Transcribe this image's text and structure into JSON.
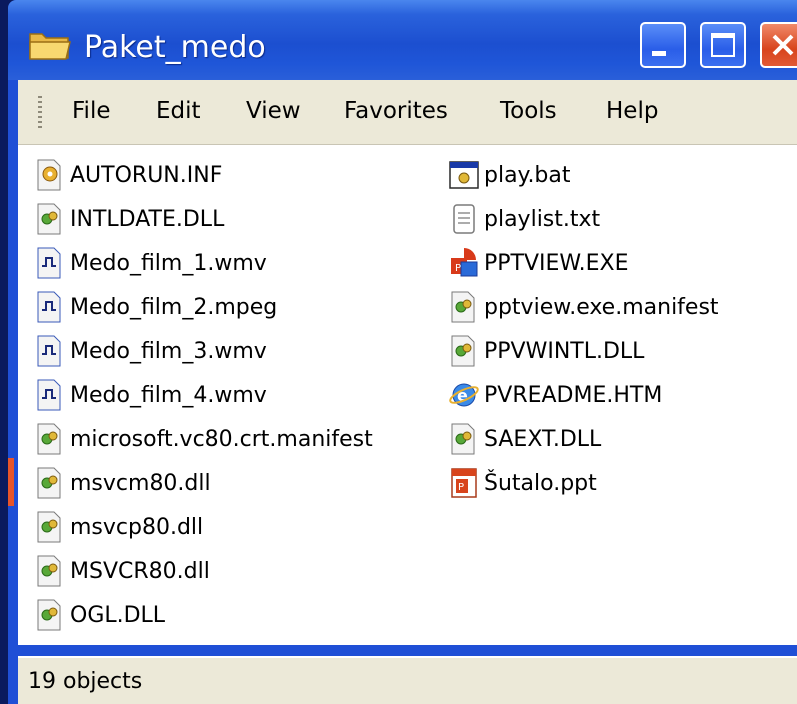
{
  "window": {
    "title": "Paket_medo"
  },
  "menu": {
    "items": [
      "File",
      "Edit",
      "View",
      "Favorites",
      "Tools",
      "Help"
    ]
  },
  "files": [
    {
      "name": "AUTORUN.INF",
      "icon": "settings-file-icon"
    },
    {
      "name": "INTLDATE.DLL",
      "icon": "dll-icon"
    },
    {
      "name": "Medo_film_1.wmv",
      "icon": "media-file-icon"
    },
    {
      "name": "Medo_film_2.mpeg",
      "icon": "media-file-icon"
    },
    {
      "name": "Medo_film_3.wmv",
      "icon": "media-file-icon"
    },
    {
      "name": "Medo_film_4.wmv",
      "icon": "media-file-icon"
    },
    {
      "name": "microsoft.vc80.crt.manifest",
      "icon": "dll-icon"
    },
    {
      "name": "msvcm80.dll",
      "icon": "dll-icon"
    },
    {
      "name": "msvcp80.dll",
      "icon": "dll-icon"
    },
    {
      "name": "MSVCR80.dll",
      "icon": "dll-icon"
    },
    {
      "name": "OGL.DLL",
      "icon": "dll-icon"
    },
    {
      "name": "play.bat",
      "icon": "batch-file-icon"
    },
    {
      "name": "playlist.txt",
      "icon": "text-file-icon"
    },
    {
      "name": "PPTVIEW.EXE",
      "icon": "powerpoint-viewer-icon"
    },
    {
      "name": "pptview.exe.manifest",
      "icon": "dll-icon"
    },
    {
      "name": "PPVWINTL.DLL",
      "icon": "dll-icon"
    },
    {
      "name": "PVREADME.HTM",
      "icon": "internet-explorer-icon"
    },
    {
      "name": "SAEXT.DLL",
      "icon": "dll-icon"
    },
    {
      "name": "Šutalo.ppt",
      "icon": "powerpoint-file-icon"
    }
  ],
  "status": {
    "text": "19 objects"
  },
  "colors": {
    "titlebar": "#1f4fd6",
    "menu_bg": "#ece9d8",
    "close_button": "#d8441c"
  }
}
